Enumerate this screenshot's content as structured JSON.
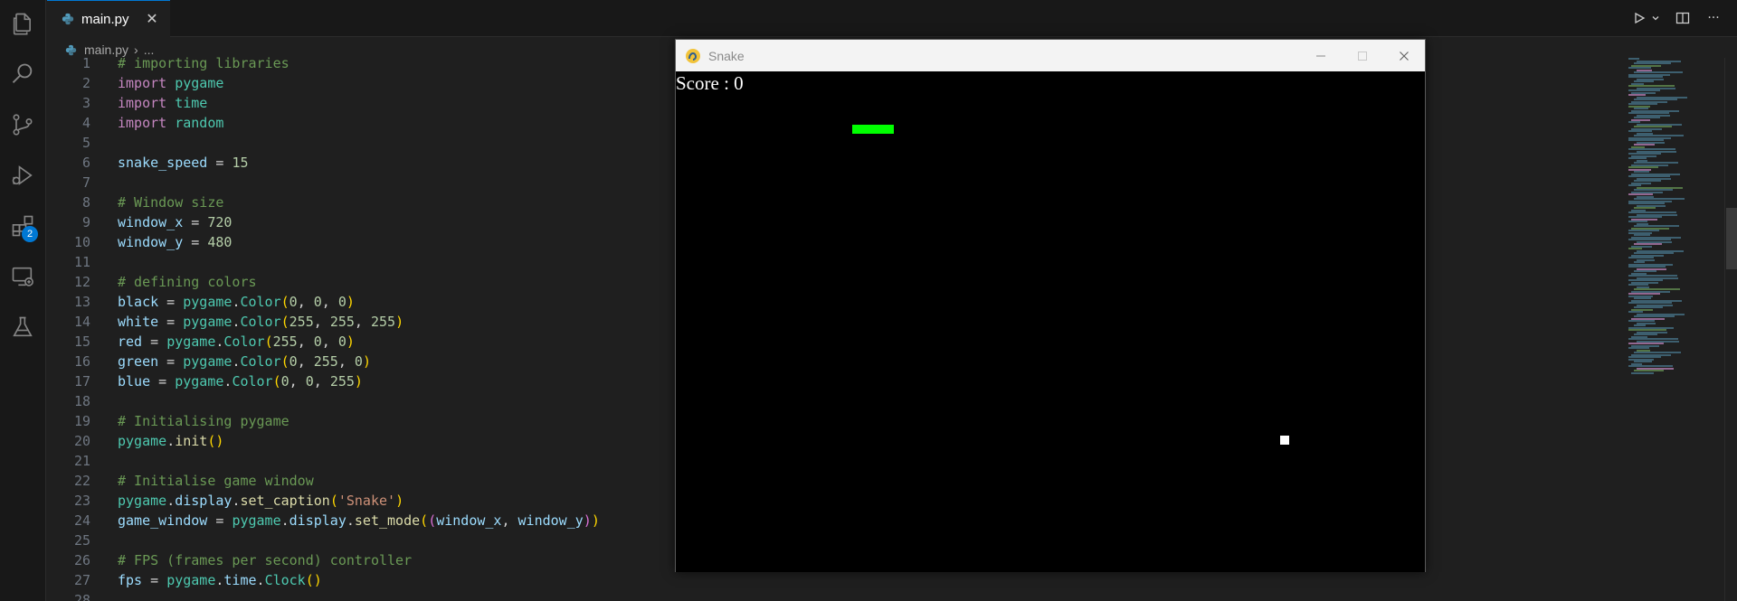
{
  "tabs": [
    {
      "label": "main.py",
      "active": true
    }
  ],
  "breadcrumb": {
    "file": "main.py",
    "more": "..."
  },
  "extensions_badge": "2",
  "accent_color": "#0078d4",
  "activity_icons": [
    "files-icon",
    "search-icon",
    "source-control-icon",
    "run-debug-icon",
    "extensions-icon",
    "remote-explorer-icon",
    "testing-icon"
  ],
  "code_lines": [
    {
      "n": "1",
      "tokens": [
        [
          "cm",
          "# importing libraries"
        ]
      ]
    },
    {
      "n": "2",
      "tokens": [
        [
          "kw",
          "import"
        ],
        [
          "op",
          " "
        ],
        [
          "cls",
          "pygame"
        ]
      ]
    },
    {
      "n": "3",
      "tokens": [
        [
          "kw",
          "import"
        ],
        [
          "op",
          " "
        ],
        [
          "cls",
          "time"
        ]
      ]
    },
    {
      "n": "4",
      "tokens": [
        [
          "kw",
          "import"
        ],
        [
          "op",
          " "
        ],
        [
          "cls",
          "random"
        ]
      ]
    },
    {
      "n": "5",
      "tokens": []
    },
    {
      "n": "6",
      "tokens": [
        [
          "id",
          "snake_speed"
        ],
        [
          "op",
          " = "
        ],
        [
          "num",
          "15"
        ]
      ]
    },
    {
      "n": "7",
      "tokens": []
    },
    {
      "n": "8",
      "tokens": [
        [
          "cm",
          "# Window size"
        ]
      ]
    },
    {
      "n": "9",
      "tokens": [
        [
          "id",
          "window_x"
        ],
        [
          "op",
          " = "
        ],
        [
          "num",
          "720"
        ]
      ]
    },
    {
      "n": "10",
      "tokens": [
        [
          "id",
          "window_y"
        ],
        [
          "op",
          " = "
        ],
        [
          "num",
          "480"
        ]
      ]
    },
    {
      "n": "11",
      "tokens": []
    },
    {
      "n": "12",
      "tokens": [
        [
          "cm",
          "# defining colors"
        ]
      ]
    },
    {
      "n": "13",
      "tokens": [
        [
          "id",
          "black"
        ],
        [
          "op",
          " = "
        ],
        [
          "cls",
          "pygame"
        ],
        [
          "op",
          "."
        ],
        [
          "cls",
          "Color"
        ],
        [
          "p1",
          "("
        ],
        [
          "num",
          "0"
        ],
        [
          "op",
          ", "
        ],
        [
          "num",
          "0"
        ],
        [
          "op",
          ", "
        ],
        [
          "num",
          "0"
        ],
        [
          "p1",
          ")"
        ]
      ]
    },
    {
      "n": "14",
      "tokens": [
        [
          "id",
          "white"
        ],
        [
          "op",
          " = "
        ],
        [
          "cls",
          "pygame"
        ],
        [
          "op",
          "."
        ],
        [
          "cls",
          "Color"
        ],
        [
          "p1",
          "("
        ],
        [
          "num",
          "255"
        ],
        [
          "op",
          ", "
        ],
        [
          "num",
          "255"
        ],
        [
          "op",
          ", "
        ],
        [
          "num",
          "255"
        ],
        [
          "p1",
          ")"
        ]
      ]
    },
    {
      "n": "15",
      "tokens": [
        [
          "id",
          "red"
        ],
        [
          "op",
          " = "
        ],
        [
          "cls",
          "pygame"
        ],
        [
          "op",
          "."
        ],
        [
          "cls",
          "Color"
        ],
        [
          "p1",
          "("
        ],
        [
          "num",
          "255"
        ],
        [
          "op",
          ", "
        ],
        [
          "num",
          "0"
        ],
        [
          "op",
          ", "
        ],
        [
          "num",
          "0"
        ],
        [
          "p1",
          ")"
        ]
      ]
    },
    {
      "n": "16",
      "tokens": [
        [
          "id",
          "green"
        ],
        [
          "op",
          " = "
        ],
        [
          "cls",
          "pygame"
        ],
        [
          "op",
          "."
        ],
        [
          "cls",
          "Color"
        ],
        [
          "p1",
          "("
        ],
        [
          "num",
          "0"
        ],
        [
          "op",
          ", "
        ],
        [
          "num",
          "255"
        ],
        [
          "op",
          ", "
        ],
        [
          "num",
          "0"
        ],
        [
          "p1",
          ")"
        ]
      ]
    },
    {
      "n": "17",
      "tokens": [
        [
          "id",
          "blue"
        ],
        [
          "op",
          " = "
        ],
        [
          "cls",
          "pygame"
        ],
        [
          "op",
          "."
        ],
        [
          "cls",
          "Color"
        ],
        [
          "p1",
          "("
        ],
        [
          "num",
          "0"
        ],
        [
          "op",
          ", "
        ],
        [
          "num",
          "0"
        ],
        [
          "op",
          ", "
        ],
        [
          "num",
          "255"
        ],
        [
          "p1",
          ")"
        ]
      ]
    },
    {
      "n": "18",
      "tokens": []
    },
    {
      "n": "19",
      "tokens": [
        [
          "cm",
          "# Initialising pygame"
        ]
      ]
    },
    {
      "n": "20",
      "tokens": [
        [
          "cls",
          "pygame"
        ],
        [
          "op",
          "."
        ],
        [
          "fn",
          "init"
        ],
        [
          "p1",
          "()"
        ]
      ]
    },
    {
      "n": "21",
      "tokens": []
    },
    {
      "n": "22",
      "tokens": [
        [
          "cm",
          "# Initialise game window"
        ]
      ]
    },
    {
      "n": "23",
      "tokens": [
        [
          "cls",
          "pygame"
        ],
        [
          "op",
          "."
        ],
        [
          "id",
          "display"
        ],
        [
          "op",
          "."
        ],
        [
          "fn",
          "set_caption"
        ],
        [
          "p1",
          "("
        ],
        [
          "str",
          "'Snake'"
        ],
        [
          "p1",
          ")"
        ]
      ]
    },
    {
      "n": "24",
      "tokens": [
        [
          "id",
          "game_window"
        ],
        [
          "op",
          " = "
        ],
        [
          "cls",
          "pygame"
        ],
        [
          "op",
          "."
        ],
        [
          "id",
          "display"
        ],
        [
          "op",
          "."
        ],
        [
          "fn",
          "set_mode"
        ],
        [
          "p1",
          "("
        ],
        [
          "p2",
          "("
        ],
        [
          "id",
          "window_x"
        ],
        [
          "op",
          ", "
        ],
        [
          "id",
          "window_y"
        ],
        [
          "p2",
          ")"
        ],
        [
          "p1",
          ")"
        ]
      ]
    },
    {
      "n": "25",
      "tokens": []
    },
    {
      "n": "26",
      "tokens": [
        [
          "cm",
          "# FPS (frames per second) controller"
        ]
      ]
    },
    {
      "n": "27",
      "tokens": [
        [
          "id",
          "fps"
        ],
        [
          "op",
          " = "
        ],
        [
          "cls",
          "pygame"
        ],
        [
          "op",
          "."
        ],
        [
          "id",
          "time"
        ],
        [
          "op",
          "."
        ],
        [
          "cls",
          "Clock"
        ],
        [
          "p1",
          "()"
        ]
      ]
    },
    {
      "n": "28",
      "tokens": []
    }
  ],
  "game_window": {
    "title": "Snake",
    "score_text": "Score : 0",
    "snake_color": "#00ff00",
    "food_color": "#ffffff"
  }
}
